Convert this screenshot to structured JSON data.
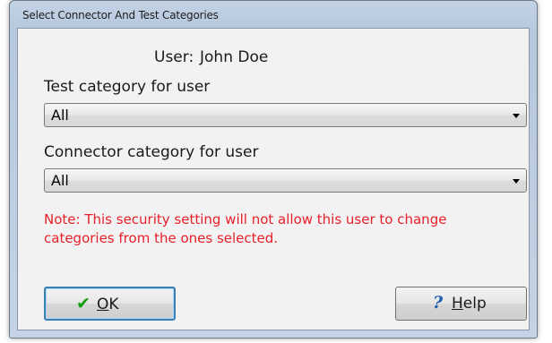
{
  "window": {
    "title": "Select Connector And Test Categories"
  },
  "user": {
    "label": "User:",
    "name": "John Doe"
  },
  "test_category": {
    "label": "Test category for user",
    "value": "All"
  },
  "connector_category": {
    "label": "Connector category for user",
    "value": "All"
  },
  "note": {
    "text": "Note: This security setting will not allow this user to change categories from the ones selected.",
    "color": "#e8202a"
  },
  "buttons": {
    "ok": {
      "mnemonic": "O",
      "rest": "K",
      "icon": "checkmark-icon"
    },
    "help": {
      "mnemonic": "H",
      "rest": "elp",
      "icon": "question-mark-icon"
    }
  }
}
